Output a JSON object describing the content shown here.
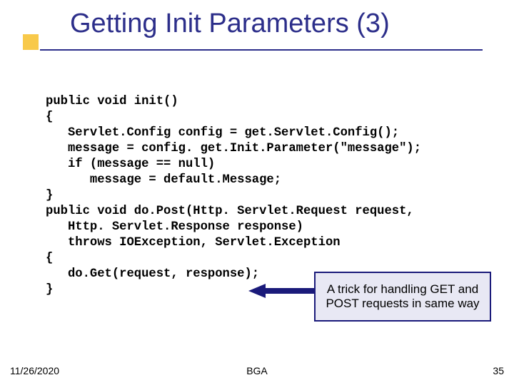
{
  "title": "Getting Init Parameters (3)",
  "code": "public void init()\n{\n   Servlet.Config config = get.Servlet.Config();\n   message = config. get.Init.Parameter(\"message\");\n   if (message == null)\n      message = default.Message;\n}\npublic void do.Post(Http. Servlet.Request request,\n   Http. Servlet.Response response)\n   throws IOException, Servlet.Exception\n{\n   do.Get(request, response);\n}",
  "callout": "A trick for handling GET and POST requests in same way",
  "footer": {
    "date": "11/26/2020",
    "center": "BGA",
    "page": "35"
  }
}
